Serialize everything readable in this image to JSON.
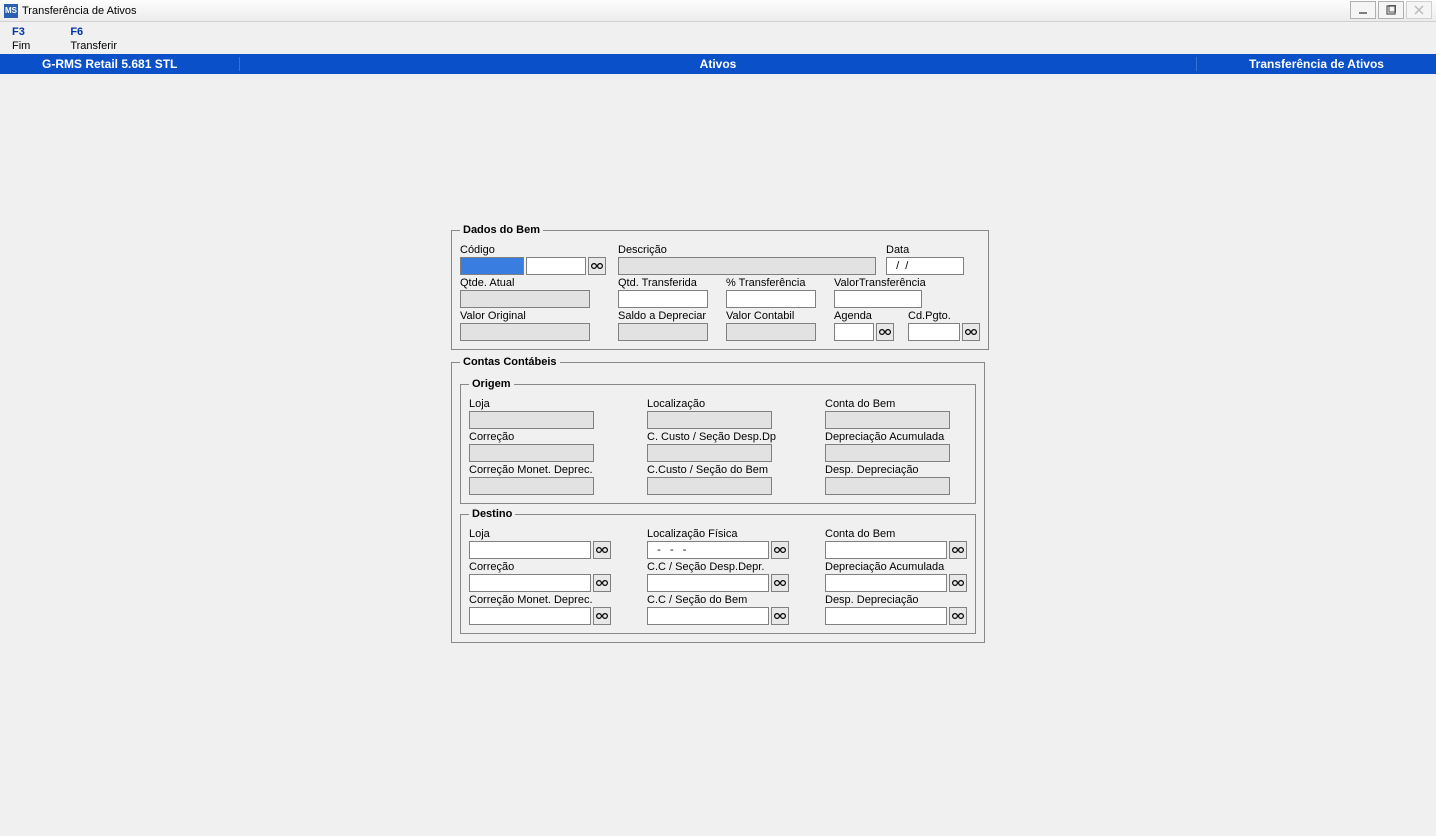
{
  "window": {
    "icon_text": "MS",
    "title": "Transferência de Ativos"
  },
  "menu": {
    "f3_key": "F3",
    "f3_label": "Fim",
    "f6_key": "F6",
    "f6_label": "Transferir"
  },
  "bluebar": {
    "left": "G-RMS Retail 5.681 STL",
    "center": "Ativos",
    "right": "Transferência de Ativos"
  },
  "dados": {
    "legend": "Dados do Bem",
    "codigo_lbl": "Código",
    "codigo_val": "",
    "descricao_lbl": "Descrição",
    "descricao_val": "",
    "data_lbl": "Data",
    "data_val": "  /  /",
    "qtde_atual_lbl": "Qtde. Atual",
    "qtde_atual_val": "",
    "qtd_transf_lbl": "Qtd. Transferida",
    "qtd_transf_val": "",
    "pct_transf_lbl": "% Transferência",
    "pct_transf_val": "",
    "valor_transf_lbl": "ValorTransferência",
    "valor_transf_val": "",
    "valor_orig_lbl": "Valor Original",
    "valor_orig_val": "",
    "saldo_dep_lbl": "Saldo a Depreciar",
    "saldo_dep_val": "",
    "valor_cont_lbl": "Valor Contabil",
    "valor_cont_val": "",
    "agenda_lbl": "Agenda",
    "agenda_val": "",
    "cdpgto_lbl": "Cd.Pgto.",
    "cdpgto_val": ""
  },
  "contas": {
    "legend": "Contas Contábeis",
    "origem": {
      "legend": "Origem",
      "loja_lbl": "Loja",
      "loja_val": "",
      "localizacao_lbl": "Localização",
      "localizacao_val": "",
      "conta_bem_lbl": "Conta do Bem",
      "conta_bem_val": "",
      "correcao_lbl": "Correção",
      "correcao_val": "",
      "ccusto_desp_lbl": "C. Custo / Seção Desp.Dp",
      "ccusto_desp_val": "",
      "deprec_acum_lbl": "Depreciação Acumulada",
      "deprec_acum_val": "",
      "corr_monet_lbl": "Correção Monet. Deprec.",
      "corr_monet_val": "",
      "ccusto_bem_lbl": "C.Custo / Seção do Bem",
      "ccusto_bem_val": "",
      "desp_deprec_lbl": "Desp. Depreciação",
      "desp_deprec_val": ""
    },
    "destino": {
      "legend": "Destino",
      "loja_lbl": "Loja",
      "loja_val": "",
      "localizacao_lbl": "Localização Física",
      "localizacao_val": "  -   -   -",
      "conta_bem_lbl": "Conta do Bem",
      "conta_bem_val": "",
      "correcao_lbl": "Correção",
      "correcao_val": "",
      "ccusto_desp_lbl": "C.C / Seção Desp.Depr.",
      "ccusto_desp_val": "",
      "deprec_acum_lbl": "Depreciação Acumulada",
      "deprec_acum_val": "",
      "corr_monet_lbl": "Correção Monet. Deprec.",
      "corr_monet_val": "",
      "ccusto_bem_lbl": "C.C / Seção do Bem",
      "ccusto_bem_val": "",
      "desp_deprec_lbl": "Desp. Depreciação",
      "desp_deprec_val": ""
    }
  }
}
